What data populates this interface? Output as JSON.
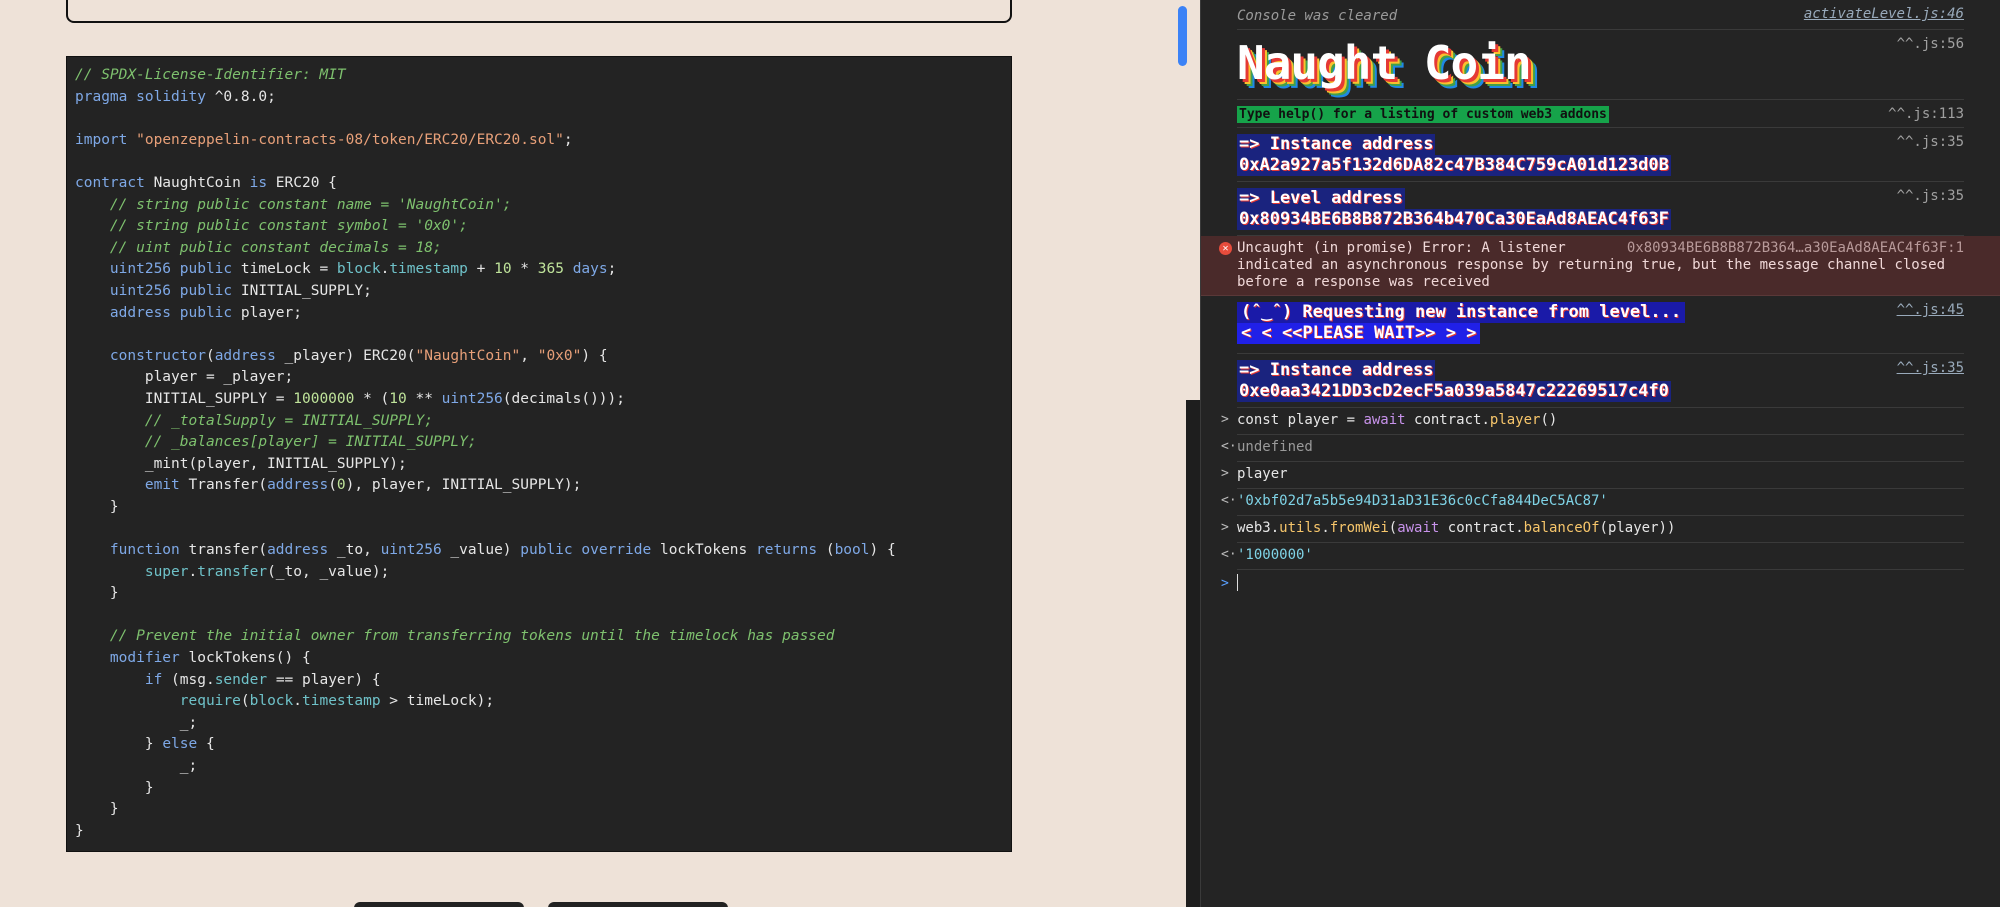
{
  "code": [
    [
      {
        "c": "cm",
        "t": "// SPDX-License-Identifier: MIT"
      }
    ],
    [
      {
        "c": "kw",
        "t": "pragma"
      },
      {
        "c": "",
        "t": " "
      },
      {
        "c": "kw",
        "t": "solidity"
      },
      {
        "c": "",
        "t": " ^0.8.0;"
      }
    ],
    [],
    [
      {
        "c": "kw",
        "t": "import"
      },
      {
        "c": "",
        "t": " "
      },
      {
        "c": "st",
        "t": "\"openzeppelin-contracts-08/token/ERC20/ERC20.sol\""
      },
      {
        "c": "",
        "t": ";"
      }
    ],
    [],
    [
      {
        "c": "kw",
        "t": "contract"
      },
      {
        "c": "",
        "t": " NaughtCoin "
      },
      {
        "c": "kw",
        "t": "is"
      },
      {
        "c": "",
        "t": " ERC20 {"
      }
    ],
    [
      {
        "c": "",
        "t": "    "
      },
      {
        "c": "cm",
        "t": "// string public constant name = 'NaughtCoin';"
      }
    ],
    [
      {
        "c": "",
        "t": "    "
      },
      {
        "c": "cm",
        "t": "// string public constant symbol = '0x0';"
      }
    ],
    [
      {
        "c": "",
        "t": "    "
      },
      {
        "c": "cm",
        "t": "// uint public constant decimals = 18;"
      }
    ],
    [
      {
        "c": "",
        "t": "    "
      },
      {
        "c": "kw",
        "t": "uint256"
      },
      {
        "c": "",
        "t": " "
      },
      {
        "c": "kw",
        "t": "public"
      },
      {
        "c": "",
        "t": " timeLock = "
      },
      {
        "c": "ty",
        "t": "block"
      },
      {
        "c": "",
        "t": "."
      },
      {
        "c": "ty",
        "t": "timestamp"
      },
      {
        "c": "",
        "t": " + "
      },
      {
        "c": "nu",
        "t": "10"
      },
      {
        "c": "",
        "t": " * "
      },
      {
        "c": "nu",
        "t": "365"
      },
      {
        "c": "",
        "t": " "
      },
      {
        "c": "kw",
        "t": "days"
      },
      {
        "c": "",
        "t": ";"
      }
    ],
    [
      {
        "c": "",
        "t": "    "
      },
      {
        "c": "kw",
        "t": "uint256"
      },
      {
        "c": "",
        "t": " "
      },
      {
        "c": "kw",
        "t": "public"
      },
      {
        "c": "",
        "t": " INITIAL_SUPPLY;"
      }
    ],
    [
      {
        "c": "",
        "t": "    "
      },
      {
        "c": "kw",
        "t": "address"
      },
      {
        "c": "",
        "t": " "
      },
      {
        "c": "kw",
        "t": "public"
      },
      {
        "c": "",
        "t": " player;"
      }
    ],
    [],
    [
      {
        "c": "",
        "t": "    "
      },
      {
        "c": "kw",
        "t": "constructor"
      },
      {
        "c": "",
        "t": "("
      },
      {
        "c": "kw",
        "t": "address"
      },
      {
        "c": "",
        "t": " _player) ERC20("
      },
      {
        "c": "st",
        "t": "\"NaughtCoin\""
      },
      {
        "c": "",
        "t": ", "
      },
      {
        "c": "st",
        "t": "\"0x0\""
      },
      {
        "c": "",
        "t": ") {"
      }
    ],
    [
      {
        "c": "",
        "t": "        player = _player;"
      }
    ],
    [
      {
        "c": "",
        "t": "        INITIAL_SUPPLY = "
      },
      {
        "c": "nu",
        "t": "1000000"
      },
      {
        "c": "",
        "t": " * ("
      },
      {
        "c": "nu",
        "t": "10"
      },
      {
        "c": "",
        "t": " ** "
      },
      {
        "c": "kw",
        "t": "uint256"
      },
      {
        "c": "",
        "t": "(decimals()));"
      }
    ],
    [
      {
        "c": "",
        "t": "        "
      },
      {
        "c": "cm",
        "t": "// _totalSupply = INITIAL_SUPPLY;"
      }
    ],
    [
      {
        "c": "",
        "t": "        "
      },
      {
        "c": "cm",
        "t": "// _balances[player] = INITIAL_SUPPLY;"
      }
    ],
    [
      {
        "c": "",
        "t": "        _mint(player, INITIAL_SUPPLY);"
      }
    ],
    [
      {
        "c": "",
        "t": "        "
      },
      {
        "c": "kw",
        "t": "emit"
      },
      {
        "c": "",
        "t": " Transfer("
      },
      {
        "c": "kw",
        "t": "address"
      },
      {
        "c": "",
        "t": "("
      },
      {
        "c": "nu",
        "t": "0"
      },
      {
        "c": "",
        "t": "), player, INITIAL_SUPPLY);"
      }
    ],
    [
      {
        "c": "",
        "t": "    }"
      }
    ],
    [],
    [
      {
        "c": "",
        "t": "    "
      },
      {
        "c": "kw",
        "t": "function"
      },
      {
        "c": "",
        "t": " transfer("
      },
      {
        "c": "kw",
        "t": "address"
      },
      {
        "c": "",
        "t": " _to, "
      },
      {
        "c": "kw",
        "t": "uint256"
      },
      {
        "c": "",
        "t": " _value) "
      },
      {
        "c": "kw",
        "t": "public"
      },
      {
        "c": "",
        "t": " "
      },
      {
        "c": "kw",
        "t": "override"
      },
      {
        "c": "",
        "t": " lockTokens "
      },
      {
        "c": "kw",
        "t": "returns"
      },
      {
        "c": "",
        "t": " ("
      },
      {
        "c": "kw",
        "t": "bool"
      },
      {
        "c": "",
        "t": ") {"
      }
    ],
    [
      {
        "c": "",
        "t": "        "
      },
      {
        "c": "ty",
        "t": "super"
      },
      {
        "c": "",
        "t": "."
      },
      {
        "c": "ty",
        "t": "transfer"
      },
      {
        "c": "",
        "t": "(_to, _value);"
      }
    ],
    [
      {
        "c": "",
        "t": "    }"
      }
    ],
    [],
    [
      {
        "c": "",
        "t": "    "
      },
      {
        "c": "cm",
        "t": "// Prevent the initial owner from transferring tokens until the timelock has passed"
      }
    ],
    [
      {
        "c": "",
        "t": "    "
      },
      {
        "c": "kw",
        "t": "modifier"
      },
      {
        "c": "",
        "t": " lockTokens() {"
      }
    ],
    [
      {
        "c": "",
        "t": "        "
      },
      {
        "c": "kw",
        "t": "if"
      },
      {
        "c": "",
        "t": " (msg."
      },
      {
        "c": "ty",
        "t": "sender"
      },
      {
        "c": "",
        "t": " == player) {"
      }
    ],
    [
      {
        "c": "",
        "t": "            "
      },
      {
        "c": "ty",
        "t": "require"
      },
      {
        "c": "",
        "t": "("
      },
      {
        "c": "ty",
        "t": "block"
      },
      {
        "c": "",
        "t": "."
      },
      {
        "c": "ty",
        "t": "timestamp"
      },
      {
        "c": "",
        "t": " > timeLock);"
      }
    ],
    [
      {
        "c": "",
        "t": "            _;"
      }
    ],
    [
      {
        "c": "",
        "t": "        } "
      },
      {
        "c": "kw",
        "t": "else"
      },
      {
        "c": "",
        "t": " {"
      }
    ],
    [
      {
        "c": "",
        "t": "            _;"
      }
    ],
    [
      {
        "c": "",
        "t": "        }"
      }
    ],
    [
      {
        "c": "",
        "t": "    }"
      }
    ],
    [
      {
        "c": "",
        "t": "}"
      }
    ]
  ],
  "console": {
    "cleared": "Console was cleared",
    "cleared_src": "activateLevel.js:46",
    "banner_title": "Naught Coin",
    "banner_src": "^^.js:56",
    "help": "Type help() for a listing of custom web3 addons",
    "help_src": "^^.js:113",
    "instance_label": "=> Instance address",
    "instance_addr": "0xA2a927a5f132d6DA82c47B384C759cA01d123d0B",
    "instance_src": "^^.js:35",
    "level_label": "=> Level address",
    "level_addr": "0x80934BE6B8B872B364b470Ca30EaAd8AEAC4f63F",
    "level_src": "^^.js:35",
    "error_text_1": "Uncaught (in promise) Error: A listener",
    "error_text_2": "indicated an asynchronous response by returning true, but the message channel closed",
    "error_text_3": "before a response was received",
    "error_src": "0x80934BE6B8B872B364…a30EaAd8AEAC4f63F:1",
    "request_line": "(ˆ‿ˆ) Requesting new instance from level...",
    "wait_line": "<  < <<PLEASE WAIT>> >  >",
    "request_src": "^^.js:45",
    "instance2_label": "=> Instance address",
    "instance2_addr": "0xe0aa3421DD3cD2ecF5a039a5847c22269517c4f0",
    "instance2_src": "^^.js:35",
    "cmd1_a": "const player = ",
    "cmd1_kw": "await",
    "cmd1_b": " contract.",
    "cmd1_fn": "player",
    "cmd1_c": "()",
    "ret1": "undefined",
    "cmd2": "player",
    "ret2": "'0xbf02d7a5b5e94D31aD31E36c0cCfa844DeC5AC87'",
    "cmd3_a": "web3.",
    "cmd3_fn1": "utils",
    "cmd3_dot": ".",
    "cmd3_fn2": "fromWei",
    "cmd3_b": "(",
    "cmd3_kw": "await",
    "cmd3_c": " contract.",
    "cmd3_fn3": "balanceOf",
    "cmd3_d": "(player))",
    "ret3": "'1000000'",
    "prompt_out": ">",
    "prompt_ret": "<·"
  }
}
